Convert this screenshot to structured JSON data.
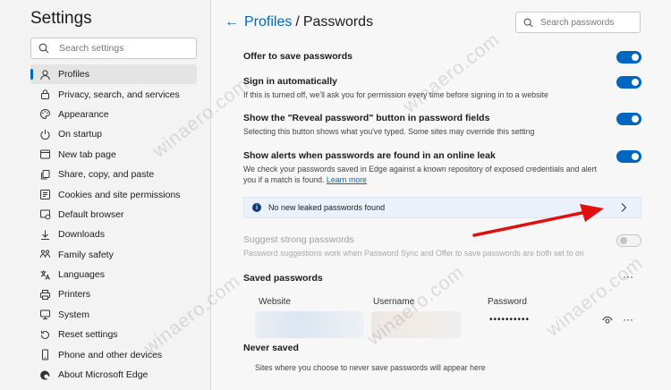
{
  "sidebar": {
    "title": "Settings",
    "search_placeholder": "Search settings",
    "items": [
      {
        "label": "Profiles",
        "icon": "profile-icon",
        "active": true
      },
      {
        "label": "Privacy, search, and services",
        "icon": "lock-icon"
      },
      {
        "label": "Appearance",
        "icon": "appearance-icon"
      },
      {
        "label": "On startup",
        "icon": "power-icon"
      },
      {
        "label": "New tab page",
        "icon": "new-tab-icon"
      },
      {
        "label": "Share, copy, and paste",
        "icon": "share-icon"
      },
      {
        "label": "Cookies and site permissions",
        "icon": "cookies-icon"
      },
      {
        "label": "Default browser",
        "icon": "default-browser-icon"
      },
      {
        "label": "Downloads",
        "icon": "download-icon"
      },
      {
        "label": "Family safety",
        "icon": "family-icon"
      },
      {
        "label": "Languages",
        "icon": "languages-icon"
      },
      {
        "label": "Printers",
        "icon": "printer-icon"
      },
      {
        "label": "System",
        "icon": "system-icon"
      },
      {
        "label": "Reset settings",
        "icon": "reset-icon"
      },
      {
        "label": "Phone and other devices",
        "icon": "phone-icon"
      },
      {
        "label": "About Microsoft Edge",
        "icon": "edge-icon"
      }
    ]
  },
  "header": {
    "back_icon": "back-arrow-icon",
    "breadcrumb_parent": "Profiles",
    "separator": "/",
    "title": "Passwords",
    "search_placeholder": "Search passwords"
  },
  "settings": {
    "offer_save": {
      "label": "Offer to save passwords",
      "on": true
    },
    "sign_in_auto": {
      "label": "Sign in automatically",
      "desc": "If this is turned off, we'll ask you for permission every time before signing in to a website",
      "on": true
    },
    "reveal_button": {
      "label": "Show the \"Reveal password\" button in password fields",
      "desc": "Selecting this button shows what you've typed. Some sites may override this setting",
      "on": true
    },
    "leak_alerts": {
      "label": "Show alerts when passwords are found in an online leak",
      "desc": "We check your passwords saved in Edge against a known repository of exposed credentials and alert you if a match is found.",
      "link": "Learn more",
      "on": true
    },
    "leak_status": "No new leaked passwords found",
    "suggest_strong": {
      "label": "Suggest strong passwords",
      "desc": "Password suggestions work when Password Sync and Offer to save passwords are both set to on",
      "on": false
    }
  },
  "saved_passwords": {
    "title": "Saved passwords",
    "more": "···",
    "columns": [
      "Website",
      "Username",
      "Password"
    ],
    "rows": [
      {
        "password_masked": "••••••••••"
      }
    ]
  },
  "never_saved": {
    "title": "Never saved",
    "desc": "Sites where you choose to never save passwords will appear here"
  },
  "watermark": "winaero.com",
  "colors": {
    "accent": "#0067c0",
    "arrow": "#e01010"
  }
}
